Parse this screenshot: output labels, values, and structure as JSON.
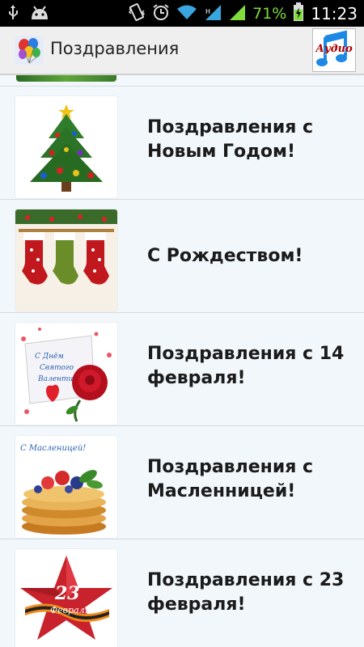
{
  "status_bar": {
    "battery_percent": "71%",
    "time": "11:23",
    "icons": [
      "usb-icon",
      "android-icon",
      "vibrate-icon",
      "alarm-icon",
      "wifi-icon",
      "signal-icon",
      "signal-icon",
      "battery-icon"
    ]
  },
  "action_bar": {
    "title": "Поздравления",
    "audio_label": "Аудио"
  },
  "list": {
    "items": [
      {
        "label": "Поздравления с Новым Годом!",
        "image": "christmas-tree-image"
      },
      {
        "label": "С Рождеством!",
        "image": "christmas-stockings-image"
      },
      {
        "label": "Поздравления с 14 февраля!",
        "image": "valentine-card-image",
        "image_text": "С Днём Святого Валентина!"
      },
      {
        "label": "Поздравления с Масленницей!",
        "image": "pancakes-image",
        "image_text": "С Масленицей!"
      },
      {
        "label": "Поздравления с 23 февраля!",
        "image": "red-star-image",
        "image_text_number": "23",
        "image_text_word": "Февраля"
      }
    ]
  },
  "colors": {
    "accent_red": "#b00000",
    "list_bg": "#f2f7fc",
    "battery_green": "#7fdc3a"
  }
}
